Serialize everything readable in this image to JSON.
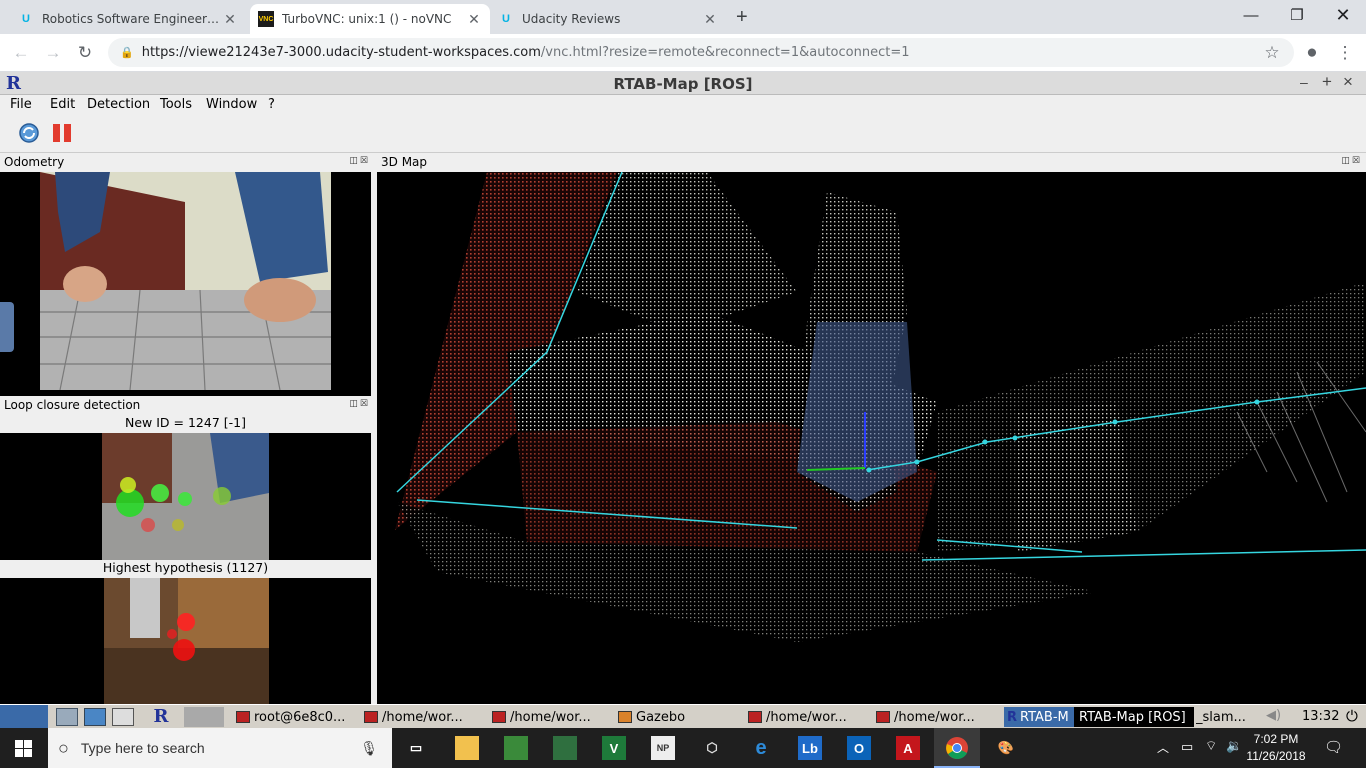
{
  "browser": {
    "tabs": [
      {
        "title": "Robotics Software Engineer - Uda",
        "icon": "udacity-icon",
        "active": false
      },
      {
        "title": "TurboVNC: unix:1 () - noVNC",
        "icon": "vnc-icon",
        "active": true
      },
      {
        "title": "Udacity Reviews",
        "icon": "udacity-icon",
        "active": false
      }
    ],
    "url_main": "https://viewe21243e7-3000.udacity-student-workspaces.com",
    "url_rest": "/vnc.html?resize=remote&reconnect=1&autoconnect=1"
  },
  "app": {
    "logo": "R",
    "title": "RTAB-Map [ROS]",
    "window_controls": [
      "–",
      "+",
      "×"
    ],
    "menu": [
      "File",
      "Edit",
      "Detection",
      "Tools",
      "Window",
      "?"
    ]
  },
  "docks": {
    "odometry": "Odometry",
    "map3d": "3D Map",
    "loop": "Loop closure detection",
    "new_id": "New ID = 1247 [-1]",
    "hypothesis": "Highest hypothesis (1127)"
  },
  "remote_taskbar": {
    "items": [
      "root@6e8c0...",
      "/home/wor...",
      "/home/wor...",
      "Gazebo",
      "/home/wor...",
      "/home/wor...",
      "RTAB-M",
      "RTAB-Map [ROS]",
      "_slam..."
    ],
    "clock": "13:32"
  },
  "windows_taskbar": {
    "search_placeholder": "Type here to search",
    "time": "7:02 PM",
    "date": "11/26/2018"
  },
  "colors": {
    "cyan": "#35d6e0",
    "wall_red": "#a33a2a",
    "accent": "#1a73e8"
  }
}
